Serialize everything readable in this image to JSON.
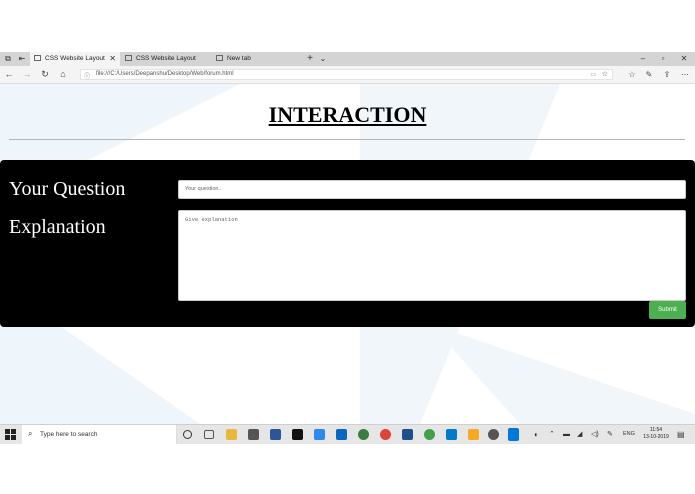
{
  "browser": {
    "tabs": [
      {
        "label": "CSS Website Layout",
        "active": true
      },
      {
        "label": "CSS Website Layout",
        "active": false
      },
      {
        "label": "New tab",
        "active": false
      }
    ],
    "new_tab_glyph": "+",
    "tab_list_glyph": "⌄",
    "url": "file:///C:/Users/Deepanshu/Desktop/Web/forum.html"
  },
  "page": {
    "title": "INTERACTION",
    "labels": {
      "question": "Your Question",
      "explanation": "Explanation"
    },
    "question_placeholder": "Your question..",
    "explanation_placeholder": "Give explanation",
    "submit_label": "Submit"
  },
  "taskbar": {
    "search_placeholder": "Type here to search",
    "language": "ENG",
    "time": "11:54",
    "date": "13-10-2019"
  },
  "colors": {
    "submit": "#4caf50",
    "form_panel": "#000000",
    "taskbar": "#e6e6e6"
  }
}
